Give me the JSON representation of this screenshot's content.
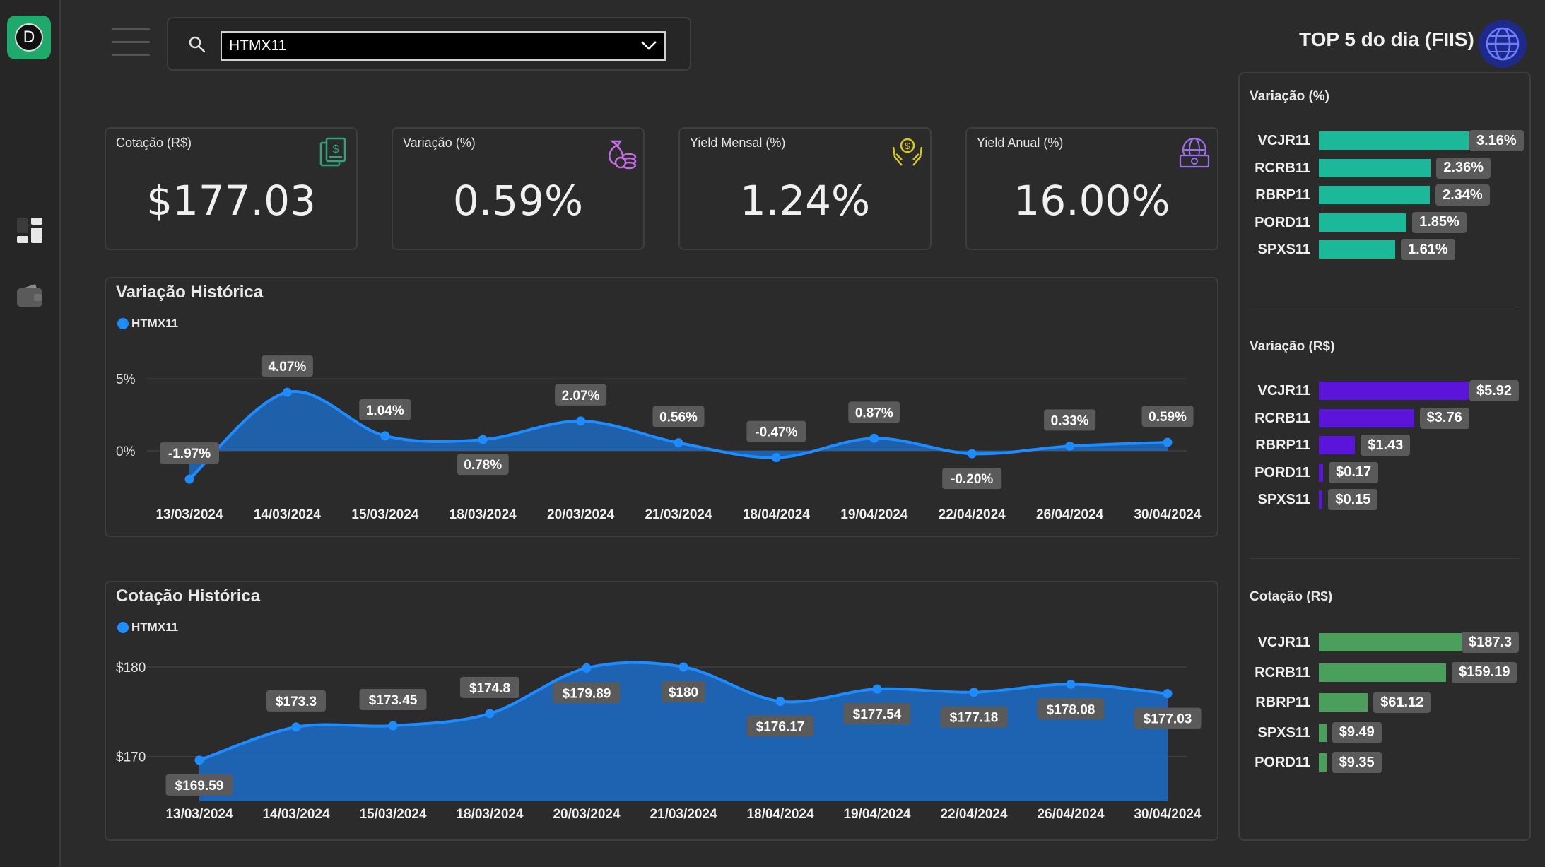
{
  "app": {
    "logo_letter": "D",
    "search": {
      "value": "HTMX11"
    }
  },
  "kpis": [
    {
      "label": "Cotação (R$)",
      "value": "$177.03",
      "icon": "document-dollar-icon",
      "icon_color": "#2fa37a"
    },
    {
      "label": "Variação (%)",
      "value": "0.59%",
      "icon": "money-bag-coins-icon",
      "icon_color": "#c46fe0"
    },
    {
      "label": "Yield Mensal (%)",
      "value": "1.24%",
      "icon": "hands-coin-icon",
      "icon_color": "#d7c81e"
    },
    {
      "label": "Yield Anual (%)",
      "value": "16.00%",
      "icon": "globe-money-icon",
      "icon_color": "#9a6fe8"
    }
  ],
  "colors": {
    "accent": "#1e8cff",
    "area": "#1d66b8",
    "teal": "#1bb99a",
    "purple": "#5b14d9",
    "green": "#4aa05b",
    "label_bg": "#5a5a5a"
  },
  "charts": {
    "variacao": {
      "title": "Variação Histórica",
      "legend": "HTMX11"
    },
    "cotacao": {
      "title": "Cotação Histórica",
      "legend": "HTMX11"
    }
  },
  "chart_data": [
    {
      "type": "area",
      "title": "Variação Histórica",
      "series": [
        {
          "name": "HTMX11",
          "values": [
            -1.97,
            4.07,
            1.04,
            0.78,
            2.07,
            0.56,
            -0.47,
            0.87,
            -0.2,
            0.33,
            0.59
          ]
        }
      ],
      "categories": [
        "13/03/2024",
        "14/03/2024",
        "15/03/2024",
        "18/03/2024",
        "20/03/2024",
        "21/03/2024",
        "18/04/2024",
        "19/04/2024",
        "22/04/2024",
        "26/04/2024",
        "30/04/2024"
      ],
      "data_labels": [
        "-1.97%",
        "4.07%",
        "1.04%",
        "0.78%",
        "2.07%",
        "0.56%",
        "-0.47%",
        "0.87%",
        "-0.20%",
        "0.33%",
        "0.59%"
      ],
      "y_ticks": [
        "5%",
        "0%"
      ],
      "y_tick_values": [
        5,
        0
      ],
      "ylim": [
        -2.6,
        5.5
      ],
      "grid": true
    },
    {
      "type": "area",
      "title": "Cotação Histórica",
      "series": [
        {
          "name": "HTMX11",
          "values": [
            169.59,
            173.3,
            173.45,
            174.8,
            179.89,
            180,
            176.17,
            177.54,
            177.18,
            178.08,
            177.03
          ]
        }
      ],
      "categories": [
        "13/03/2024",
        "14/03/2024",
        "15/03/2024",
        "18/03/2024",
        "20/03/2024",
        "21/03/2024",
        "18/04/2024",
        "19/04/2024",
        "22/04/2024",
        "26/04/2024",
        "30/04/2024"
      ],
      "data_labels": [
        "$169.59",
        "$173.3",
        "$173.45",
        "$174.8",
        "$179.89",
        "$180",
        "$176.17",
        "$177.54",
        "$177.18",
        "$178.08",
        "$177.03"
      ],
      "y_ticks": [
        "$180",
        "$170"
      ],
      "y_tick_values": [
        180,
        170
      ],
      "ylim": [
        165,
        181.5
      ],
      "grid": true
    },
    {
      "type": "bar",
      "title": "Variação (%)",
      "categories": [
        "VCJR11",
        "RCRB11",
        "RBRP11",
        "PORD11",
        "SPXS11"
      ],
      "values": [
        3.16,
        2.36,
        2.34,
        1.85,
        1.61
      ],
      "labels": [
        "3.16%",
        "2.36%",
        "2.34%",
        "1.85%",
        "1.61%"
      ]
    },
    {
      "type": "bar",
      "title": "Variação (R$)",
      "categories": [
        "VCJR11",
        "RCRB11",
        "RBRP11",
        "PORD11",
        "SPXS11"
      ],
      "values": [
        5.92,
        3.76,
        1.43,
        0.17,
        0.15
      ],
      "labels": [
        "$5.92",
        "$3.76",
        "$1.43",
        "$0.17",
        "$0.15"
      ]
    },
    {
      "type": "bar",
      "title": "Cotação (R$)",
      "categories": [
        "VCJR11",
        "RCRB11",
        "RBRP11",
        "SPXS11",
        "PORD11"
      ],
      "values": [
        187.3,
        159.19,
        61.12,
        9.49,
        9.35
      ],
      "labels": [
        "$187.3",
        "$159.19",
        "$61.12",
        "$9.49",
        "$9.35"
      ]
    }
  ],
  "top5": {
    "title": "TOP 5 do dia (FIIS)",
    "sections": [
      "Variação (%)",
      "Variação (R$)",
      "Cotação (R$)"
    ]
  }
}
